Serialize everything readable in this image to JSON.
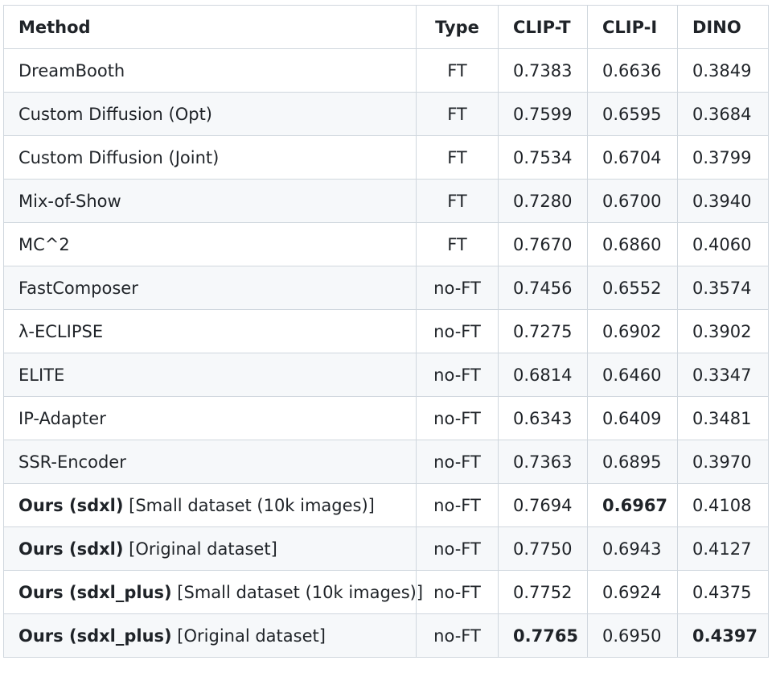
{
  "headers": [
    "Method",
    "Type",
    "CLIP-T",
    "CLIP-I",
    "DINO"
  ],
  "rows": [
    {
      "method_bold": "",
      "method_rest": "DreamBooth",
      "type": "FT",
      "clip_t": "0.7383",
      "clip_i": "0.6636",
      "dino": "0.3849"
    },
    {
      "method_bold": "",
      "method_rest": "Custom Diffusion (Opt)",
      "type": "FT",
      "clip_t": "0.7599",
      "clip_i": "0.6595",
      "dino": "0.3684"
    },
    {
      "method_bold": "",
      "method_rest": "Custom Diffusion (Joint)",
      "type": "FT",
      "clip_t": "0.7534",
      "clip_i": "0.6704",
      "dino": "0.3799"
    },
    {
      "method_bold": "",
      "method_rest": "Mix-of-Show",
      "type": "FT",
      "clip_t": "0.7280",
      "clip_i": "0.6700",
      "dino": "0.3940"
    },
    {
      "method_bold": "",
      "method_rest": "MC^2",
      "type": "FT",
      "clip_t": "0.7670",
      "clip_i": "0.6860",
      "dino": "0.4060"
    },
    {
      "method_bold": "",
      "method_rest": "FastComposer",
      "type": "no-FT",
      "clip_t": "0.7456",
      "clip_i": "0.6552",
      "dino": "0.3574"
    },
    {
      "method_bold": "",
      "method_rest": "λ-ECLIPSE",
      "type": "no-FT",
      "clip_t": "0.7275",
      "clip_i": "0.6902",
      "dino": "0.3902"
    },
    {
      "method_bold": "",
      "method_rest": "ELITE",
      "type": "no-FT",
      "clip_t": "0.6814",
      "clip_i": "0.6460",
      "dino": "0.3347"
    },
    {
      "method_bold": "",
      "method_rest": "IP-Adapter",
      "type": "no-FT",
      "clip_t": "0.6343",
      "clip_i": "0.6409",
      "dino": "0.3481"
    },
    {
      "method_bold": "",
      "method_rest": "SSR-Encoder",
      "type": "no-FT",
      "clip_t": "0.7363",
      "clip_i": "0.6895",
      "dino": "0.3970"
    },
    {
      "method_bold": "Ours (sdxl)",
      "method_rest": " [Small dataset (10k images)]",
      "type": "no-FT",
      "clip_t": "0.7694",
      "clip_i": "0.6967",
      "dino": "0.4108",
      "bold_cols": [
        "clip_i"
      ]
    },
    {
      "method_bold": "Ours (sdxl)",
      "method_rest": " [Original dataset]",
      "type": "no-FT",
      "clip_t": "0.7750",
      "clip_i": "0.6943",
      "dino": "0.4127"
    },
    {
      "method_bold": "Ours (sdxl_plus)",
      "method_rest": " [Small dataset (10k images)]",
      "type": "no-FT",
      "clip_t": "0.7752",
      "clip_i": "0.6924",
      "dino": "0.4375"
    },
    {
      "method_bold": "Ours (sdxl_plus)",
      "method_rest": " [Original dataset]",
      "type": "no-FT",
      "clip_t": "0.7765",
      "clip_i": "0.6950",
      "dino": "0.4397",
      "bold_cols": [
        "clip_t",
        "dino"
      ]
    }
  ]
}
